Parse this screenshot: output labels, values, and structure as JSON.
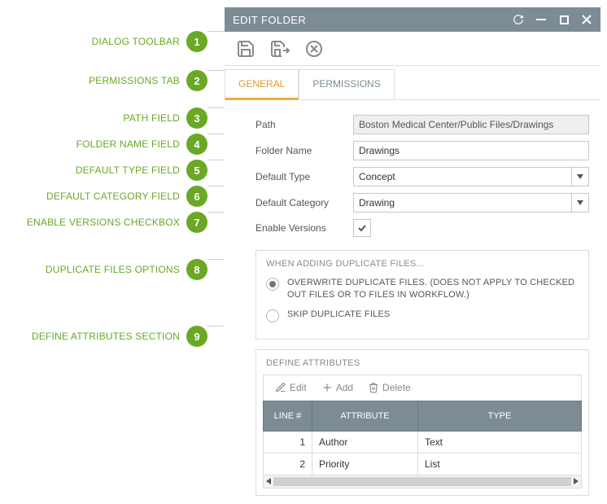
{
  "callouts": [
    {
      "label": "DIALOG TOOLBAR",
      "num": "1"
    },
    {
      "label": "PERMISSIONS TAB",
      "num": "2"
    },
    {
      "label": "PATH FIELD",
      "num": "3"
    },
    {
      "label": "FOLDER NAME FIELD",
      "num": "4"
    },
    {
      "label": "DEFAULT TYPE FIELD",
      "num": "5"
    },
    {
      "label": "DEFAULT CATEGORY FIELD",
      "num": "6"
    },
    {
      "label": "ENABLE VERSIONS CHECKBOX",
      "num": "7"
    },
    {
      "label": "DUPLICATE FILES OPTIONS",
      "num": "8"
    },
    {
      "label": "DEFINE ATTRIBUTES SECTION",
      "num": "9"
    }
  ],
  "dialog": {
    "title": "EDIT FOLDER",
    "tabs": {
      "general": "GENERAL",
      "permissions": "PERMISSIONS"
    },
    "fields": {
      "path_label": "Path",
      "path_value": "Boston Medical Center/Public Files/Drawings",
      "name_label": "Folder Name",
      "name_value": "Drawings",
      "type_label": "Default Type",
      "type_value": "Concept",
      "category_label": "Default Category",
      "category_value": "Drawing",
      "versions_label": "Enable Versions"
    },
    "dup": {
      "title": "WHEN ADDING DUPLICATE FILES...",
      "overwrite": "OVERWRITE DUPLICATE FILES. (DOES NOT APPLY TO CHECKED OUT FILES OR TO FILES IN WORKFLOW.)",
      "skip": "SKIP DUPLICATE FILES"
    },
    "attr": {
      "title": "DEFINE ATTRIBUTES",
      "edit": "Edit",
      "add": "Add",
      "delete": "Delete",
      "col_line": "LINE #",
      "col_attr": "ATTRIBUTE",
      "col_type": "TYPE",
      "rows": [
        {
          "line": "1",
          "attr": "Author",
          "type": "Text"
        },
        {
          "line": "2",
          "attr": "Priority",
          "type": "List"
        }
      ]
    }
  }
}
